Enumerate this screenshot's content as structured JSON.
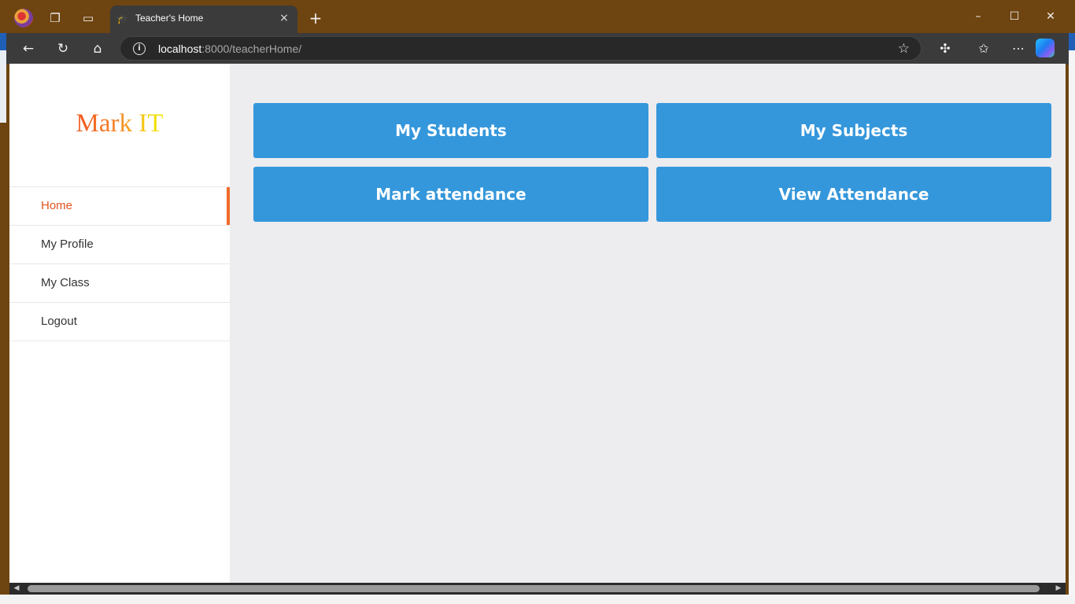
{
  "browser": {
    "tab_title": "Teacher's Home",
    "tab_close": "×",
    "new_tab": "+",
    "window_controls": {
      "minimize": "–",
      "maximize": "☐",
      "close": "✕"
    },
    "url_host": "localhost",
    "url_path": ":8000/teacherHome/",
    "icons": {
      "tab_favicon": "graduation-cap-icon",
      "workspaces": "workspaces-icon",
      "tab_actions": "tab-actions-icon",
      "back": "arrow-left-icon",
      "refresh": "refresh-icon",
      "home": "home-icon",
      "info": "info-icon",
      "favorite": "star-icon",
      "extensions": "puzzle-icon",
      "favorites": "favorites-icon",
      "more": "more-icon",
      "copilot": "copilot-icon"
    },
    "colors": {
      "frame": "#6e4410",
      "toolbar": "#3b3b3b"
    }
  },
  "sidebar": {
    "brand": "Mark IT",
    "items": [
      {
        "label": "Home",
        "active": true
      },
      {
        "label": "My Profile",
        "active": false
      },
      {
        "label": "My Class",
        "active": false
      },
      {
        "label": "Logout",
        "active": false
      }
    ]
  },
  "main": {
    "tiles": [
      {
        "label": "My Students"
      },
      {
        "label": "My Subjects"
      },
      {
        "label": "Mark attendance"
      },
      {
        "label": "View Attendance"
      }
    ]
  },
  "colors": {
    "accent": "#e2541e",
    "tile": "#3597db",
    "content_bg": "#edecef"
  }
}
